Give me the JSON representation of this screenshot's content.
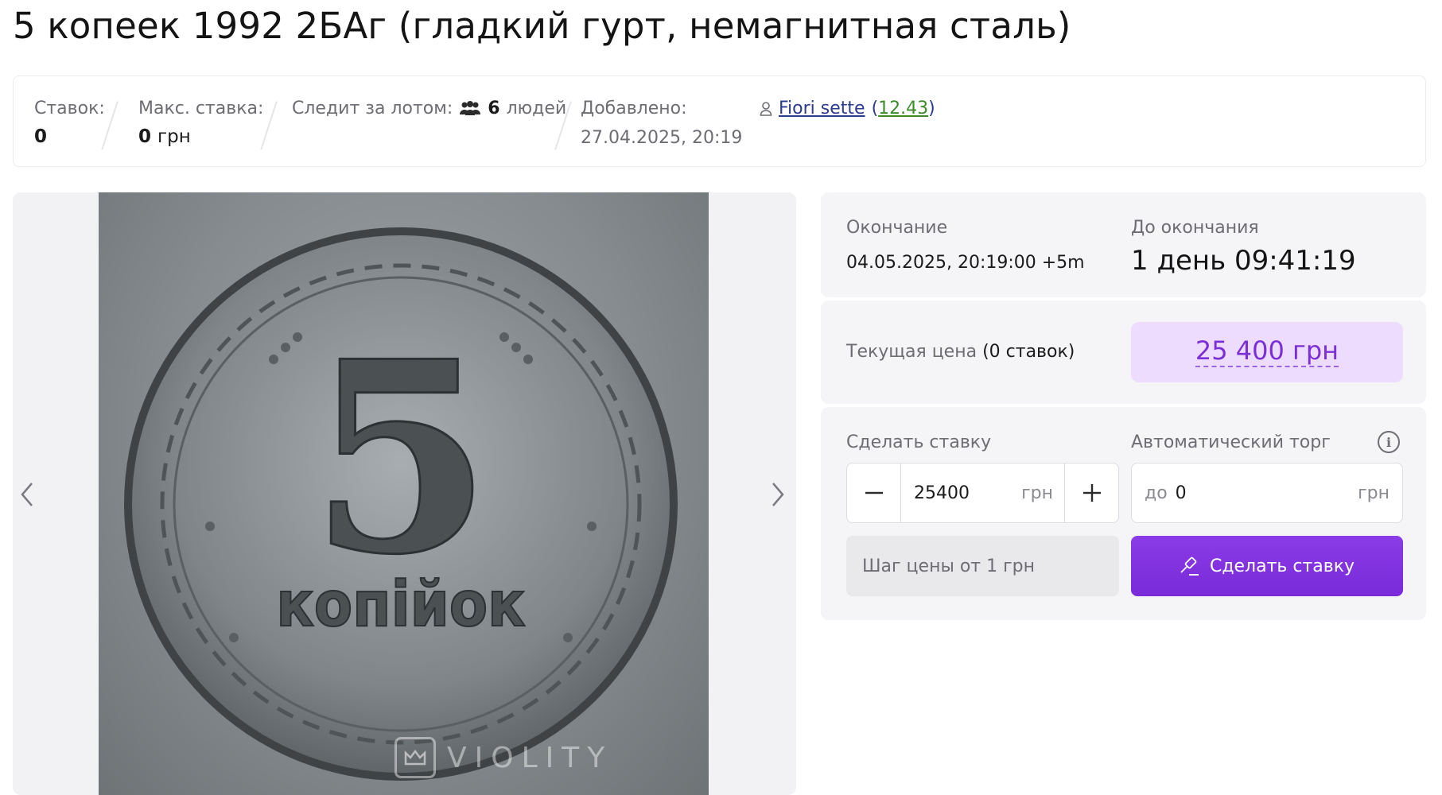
{
  "lot": {
    "title": "5 копеек 1992 2БАг (гладкий гурт, немагнитная сталь)"
  },
  "stats": {
    "bids_label": "Ставок:",
    "bids_value": "0",
    "max_bid_label": "Макс. ставка:",
    "max_bid_value": "0",
    "max_bid_unit": "грн",
    "watchers_label": "Следит за лотом:",
    "watchers_count": "6",
    "watchers_unit": "людей",
    "added_label": "Добавлено:",
    "added_value": "27.04.2025, 20:19",
    "seller_name": "Fiori sette",
    "seller_rating": "12.43"
  },
  "gallery": {
    "coin_value": "5",
    "coin_text": "копійок",
    "watermark": "VIOLITY",
    "prev_icon": "chevron-left-icon",
    "next_icon": "chevron-right-icon"
  },
  "auction": {
    "end_label": "Окончание",
    "end_value": "04.05.2025, 20:19:00 +5m",
    "left_label": "До окончания",
    "left_value": "1 день 09:41:19",
    "price_label": "Текущая цена",
    "price_bids": "(0 ставок)",
    "price_value": "25 400 грн",
    "bid_label": "Сделать ставку",
    "bid_value": "25400",
    "bid_unit": "грн",
    "auto_label": "Автоматический торг",
    "auto_prefix": "до",
    "auto_value": "0",
    "auto_unit": "грн",
    "step_info": "Шаг цены от 1 грн",
    "bid_button": "Сделать ставку",
    "accent_color": "#7b2fd6"
  }
}
